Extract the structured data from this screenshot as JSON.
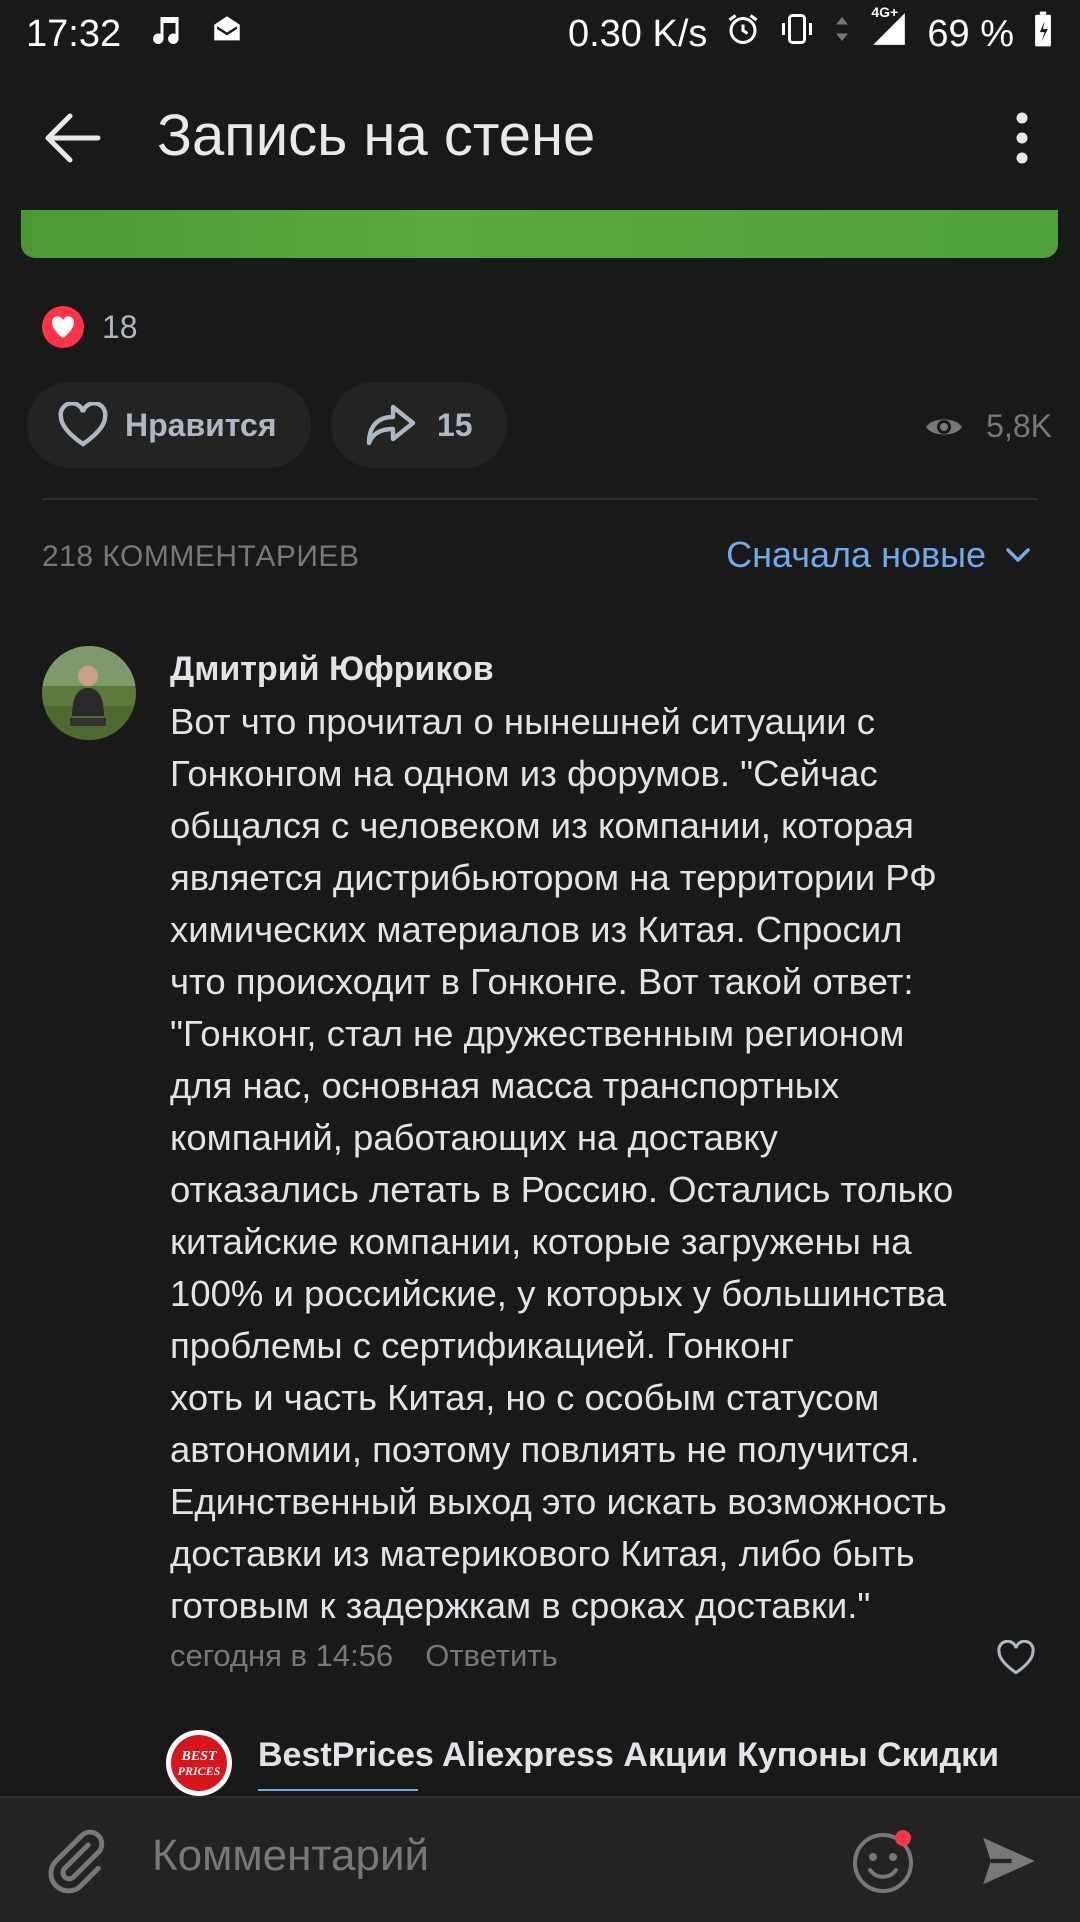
{
  "status_bar": {
    "time": "17:32",
    "net_speed": "0.30 K/s",
    "network": "4G+",
    "battery": "69 %",
    "icons": [
      "music-icon",
      "mail-icon",
      "alarm-icon",
      "vibrate-icon",
      "data-icon",
      "signal-icon",
      "battery-icon"
    ]
  },
  "header": {
    "title": "Запись на стене",
    "back_icon": "arrow-left-icon",
    "menu_icon": "more-vertical-icon"
  },
  "post": {
    "likes_count": "18",
    "like_label": "Нравится",
    "shares_count": "15",
    "views": "5,8K"
  },
  "comments": {
    "count_label": "218 КОММЕНТАРИЕВ",
    "sort_label": "Сначала новые",
    "items": [
      {
        "author": "Дмитрий Юфриков",
        "text": "Вот что прочитал о нынешней ситуации с\nГонконгом на одном из форумов. \"Сейчас\nобщался с человеком из компании, которая\nявляется дистрибьютором на территории РФ\nхимических материалов из Китая. Спросил\nчто происходит в Гонконге. Вот такой ответ:\n\"Гонконг, стал не дружественным регионом\nдля нас, основная масса транспортных\nкомпаний, работающих на доставку\nотказались летать в Россию. Остались только\nкитайские компании, которые загружены на\n100% и российские, у которых у большинства\nпроблемы с сертификацией. Гонконг\nхоть и часть Китая, но с особым статусом\nавтономии, поэтому повлиять не получится.\nЕдинственный выход это искать возможность\nдоставки из материкового Китая, либо быть\nготовым к задержкам в сроках доставки.\"",
        "time": "сегодня в 14:56",
        "reply_label": "Ответить"
      },
      {
        "author": "BestPrices Aliexpress Акции Купоны Скидки",
        "avatar_text": "BEST PRICES"
      }
    ]
  },
  "composer": {
    "placeholder": "Комментарий"
  },
  "colors": {
    "background": "#19191a",
    "accent": "#71aaeb",
    "like_red": "#ff3347",
    "secondary_text": "#76787a"
  }
}
